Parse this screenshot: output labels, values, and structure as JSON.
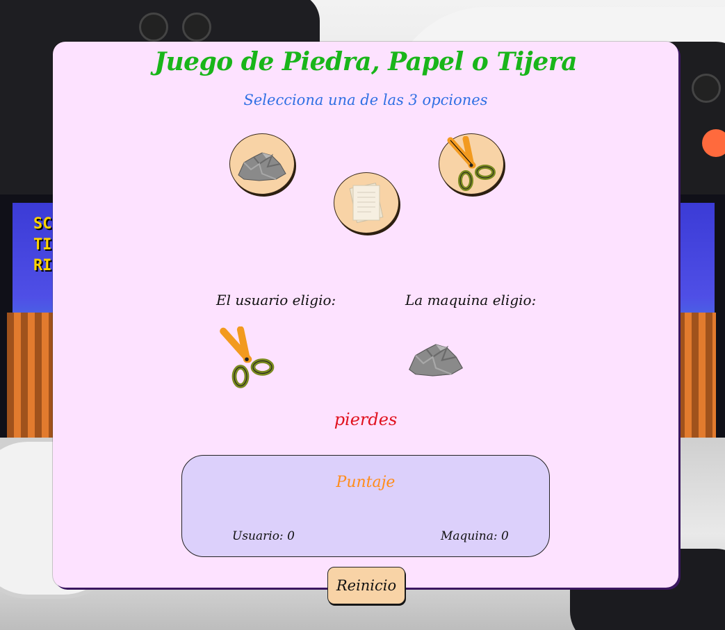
{
  "header": {
    "title": "Juego de Piedra, Papel o Tijera",
    "subtitle": "Selecciona una de las 3 opciones"
  },
  "options": [
    {
      "name": "piedra",
      "icon": "rock-icon"
    },
    {
      "name": "papel",
      "icon": "paper-icon"
    },
    {
      "name": "tijera",
      "icon": "scissors-icon"
    }
  ],
  "choices": {
    "user_label": "El usuario eligio:",
    "machine_label": "La maquina eligio:",
    "user_choice_icon": "scissors-icon",
    "machine_choice_icon": "rock-icon"
  },
  "result": {
    "text": "pierdes",
    "color": "#e0101e"
  },
  "score": {
    "title": "Puntaje",
    "user": "Usuario: 0",
    "machine": "Maquina: 0"
  },
  "reset_button": {
    "label": "Reinicio"
  },
  "colors": {
    "title": "#19b51a",
    "subtitle": "#2f6fe3",
    "card": "#fde2ff",
    "score_panel": "#dcd0fb",
    "score_title": "#ff8c1a",
    "button": "#f8d3a6"
  }
}
